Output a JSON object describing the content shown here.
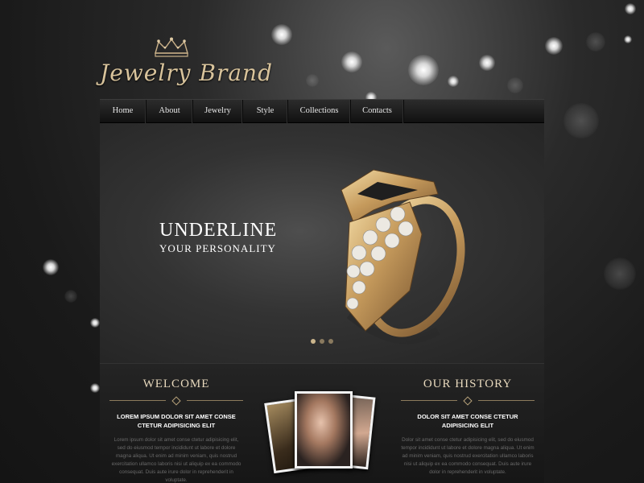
{
  "brand": {
    "logo_text": "Jewelry Brand"
  },
  "nav": {
    "items": [
      "Home",
      "About",
      "Jewelry",
      "Style",
      "Collections",
      "Contacts"
    ]
  },
  "hero": {
    "headline": "UNDERLINE",
    "subline": "YOUR PERSONALITY",
    "slide_count": 3,
    "active_slide": 1
  },
  "welcome": {
    "title": "WELCOME",
    "subtitle": "LOREM IPSUM DOLOR SIT AMET CONSE CTETUR ADIPISICING ELIT",
    "body": "Lorem ipsum dolor sit amet conse ctetur adipisicing elit, sed do eiusmod tempor incididunt ut labore et dolore magna aliqua. Ut enim ad minim veniam, quis nostrud exercitation ullamco laboris nisi ut aliquip ex ea commodo consequat. Duis aute irure dolor in reprehenderit in voluptate."
  },
  "history": {
    "title": "OUR HISTORY",
    "subtitle": "DOLOR SIT AMET CONSE CTETUR ADIPISICING ELIT",
    "body": "Dolor sit amet conse ctetur adipisicing elit, sed do eiusmod tempor incididunt ut labore et dolore magna aliqua. Ut enim ad minim veniam, quis nostrud exercitation ullamco laboris nisi ut aliquip ex ea commodo consequat. Duis aute irure dolor in reprehenderit in voluptate."
  },
  "colors": {
    "accent_gold": "#d8c39b",
    "background": "#1a1a1a",
    "nav_text": "#e6e6e6"
  }
}
